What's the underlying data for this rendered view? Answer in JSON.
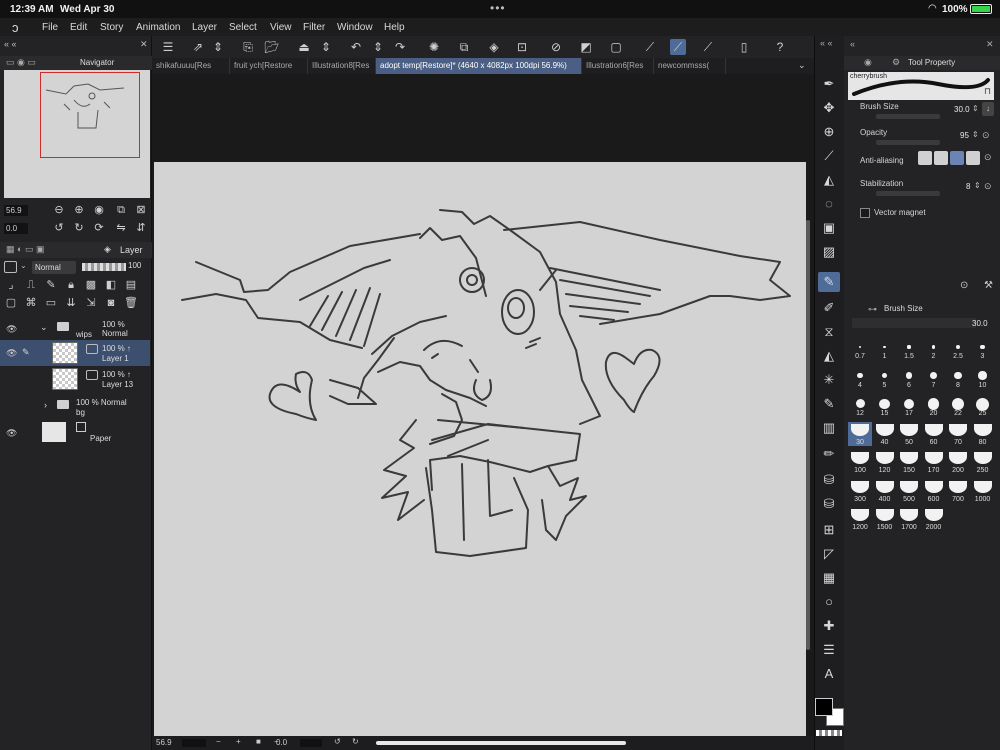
{
  "status": {
    "time": "12:39 AM",
    "date": "Wed Apr 30",
    "battery": "100%"
  },
  "menu": [
    "File",
    "Edit",
    "Story",
    "Animation",
    "Layer",
    "Select",
    "View",
    "Filter",
    "Window",
    "Help"
  ],
  "tabs": [
    {
      "label": "shikafuuuu[Res",
      "active": false
    },
    {
      "label": "fruit ych[Restore",
      "active": false
    },
    {
      "label": "Illustration8[Res",
      "active": false
    },
    {
      "label": "adopt temp[Restore]* (4640 x 4082px 100dpi 56.9%)",
      "active": true
    },
    {
      "label": "Illustration6[Res",
      "active": false
    },
    {
      "label": "newcommsss(",
      "active": false
    }
  ],
  "navigator": {
    "title": "Navigator",
    "zoom": "56.9",
    "angle": "0.0"
  },
  "layer_panel": {
    "title": "Layer",
    "blend_mode": "Normal",
    "opacity": "100",
    "layers": [
      {
        "line1": "100 %  Normal",
        "line2": "wips",
        "kind": "folder"
      },
      {
        "line1": "100 %  ↑",
        "line2": "Layer 1",
        "kind": "raster",
        "selected": true
      },
      {
        "line1": "100 %  ↑",
        "line2": "Layer 13",
        "kind": "raster"
      },
      {
        "line1": "100 %  Normal",
        "line2": "bg",
        "kind": "folder"
      },
      {
        "line1": "",
        "line2": "Paper",
        "kind": "paper"
      }
    ]
  },
  "tool_property": {
    "title": "Tool Property",
    "brush_name": "cherrybrush",
    "brush_size_label": "Brush Size",
    "brush_size": "30.0",
    "opacity_label": "Opacity",
    "opacity": "95",
    "antialias_label": "Anti-aliasing",
    "stabilization_label": "Stabilization",
    "stabilization": "8",
    "vector_magnet_label": "Vector magnet"
  },
  "brush_size_palette": {
    "title": "Brush Size",
    "value": "30.0",
    "sizes": [
      "0.7",
      "1",
      "1.5",
      "2",
      "2.5",
      "3",
      "4",
      "5",
      "6",
      "7",
      "8",
      "10",
      "12",
      "15",
      "17",
      "20",
      "22",
      "25",
      "30",
      "40",
      "50",
      "60",
      "70",
      "80",
      "100",
      "120",
      "150",
      "170",
      "200",
      "250",
      "300",
      "400",
      "500",
      "600",
      "700",
      "1000",
      "1200",
      "1500",
      "1700",
      "2000"
    ],
    "selected": "30"
  },
  "bottom": {
    "zoom": "56.9",
    "angle": "0.0"
  }
}
